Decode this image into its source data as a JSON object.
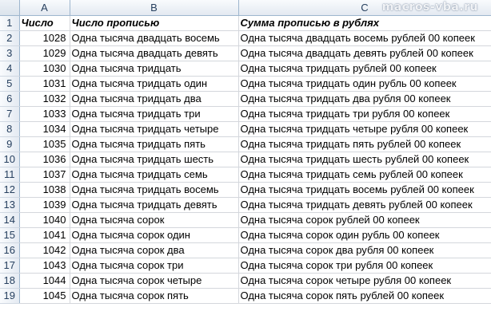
{
  "sheet": {
    "columns": [
      "A",
      "B",
      "C"
    ],
    "headers": {
      "row_number": "1",
      "number": "Число",
      "in_words": "Число прописью",
      "sum_in_words": "Сумма прописью в рублях"
    },
    "rows": [
      {
        "row": "2",
        "number": "1028",
        "words": "Одна тысяча двадцать восемь",
        "sum": "Одна тысяча двадцать восемь рублей 00 копеек"
      },
      {
        "row": "3",
        "number": "1029",
        "words": "Одна тысяча двадцать девять",
        "sum": "Одна тысяча двадцать девять рублей 00 копеек"
      },
      {
        "row": "4",
        "number": "1030",
        "words": "Одна тысяча тридцать",
        "sum": "Одна тысяча тридцать рублей 00 копеек"
      },
      {
        "row": "5",
        "number": "1031",
        "words": "Одна тысяча тридцать один",
        "sum": "Одна тысяча тридцать один рубль 00 копеек"
      },
      {
        "row": "6",
        "number": "1032",
        "words": "Одна тысяча тридцать два",
        "sum": "Одна тысяча тридцать два рубля 00 копеек"
      },
      {
        "row": "7",
        "number": "1033",
        "words": "Одна тысяча тридцать три",
        "sum": "Одна тысяча тридцать три рубля 00 копеек"
      },
      {
        "row": "8",
        "number": "1034",
        "words": "Одна тысяча тридцать четыре",
        "sum": "Одна тысяча тридцать четыре рубля 00 копеек"
      },
      {
        "row": "9",
        "number": "1035",
        "words": "Одна тысяча тридцать пять",
        "sum": "Одна тысяча тридцать пять рублей 00 копеек"
      },
      {
        "row": "10",
        "number": "1036",
        "words": "Одна тысяча тридцать шесть",
        "sum": "Одна тысяча тридцать шесть рублей 00 копеек"
      },
      {
        "row": "11",
        "number": "1037",
        "words": "Одна тысяча тридцать семь",
        "sum": "Одна тысяча тридцать семь рублей 00 копеек"
      },
      {
        "row": "12",
        "number": "1038",
        "words": "Одна тысяча тридцать восемь",
        "sum": "Одна тысяча тридцать восемь рублей 00 копеек"
      },
      {
        "row": "13",
        "number": "1039",
        "words": "Одна тысяча тридцать девять",
        "sum": "Одна тысяча тридцать девять рублей 00 копеек"
      },
      {
        "row": "14",
        "number": "1040",
        "words": "Одна тысяча сорок",
        "sum": "Одна тысяча сорок рублей 00 копеек"
      },
      {
        "row": "15",
        "number": "1041",
        "words": "Одна тысяча сорок один",
        "sum": "Одна тысяча сорок один рубль 00 копеек"
      },
      {
        "row": "16",
        "number": "1042",
        "words": "Одна тысяча сорок два",
        "sum": "Одна тысяча сорок два рубля 00 копеек"
      },
      {
        "row": "17",
        "number": "1043",
        "words": "Одна тысяча сорок три",
        "sum": "Одна тысяча сорок три рубля 00 копеек"
      },
      {
        "row": "18",
        "number": "1044",
        "words": "Одна тысяча сорок четыре",
        "sum": "Одна тысяча сорок четыре рубля 00 копеек"
      },
      {
        "row": "19",
        "number": "1045",
        "words": "Одна тысяча сорок пять",
        "sum": "Одна тысяча сорок пять рублей 00 копеек"
      }
    ]
  },
  "watermark": "macros-vba.ru",
  "colors": {
    "header_gradient_top": "#f9fbfd",
    "header_gradient_bottom": "#e3e9f1",
    "header_text": "#27405f",
    "gridline": "#d4d7dc"
  }
}
